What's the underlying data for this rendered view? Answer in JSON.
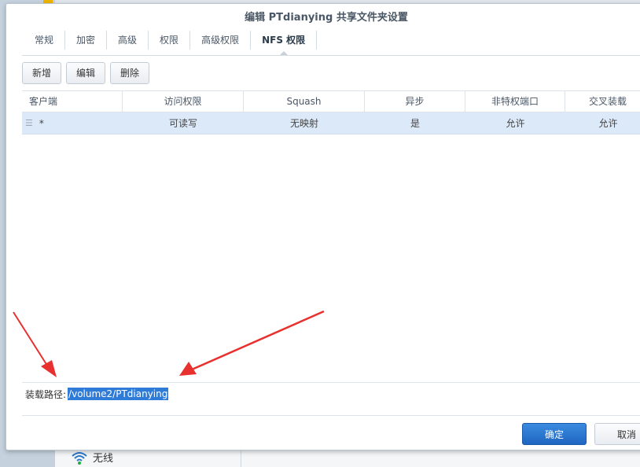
{
  "dialog": {
    "title": "编辑 PTdianying 共享文件夹设置"
  },
  "tabs": [
    {
      "label": "常规"
    },
    {
      "label": "加密"
    },
    {
      "label": "高级"
    },
    {
      "label": "权限"
    },
    {
      "label": "高级权限"
    },
    {
      "label": "NFS 权限",
      "active": true
    }
  ],
  "toolbar": {
    "add_label": "新增",
    "edit_label": "编辑",
    "delete_label": "删除"
  },
  "grid": {
    "headers": [
      "客户端",
      "访问权限",
      "Squash",
      "异步",
      "非特权端口",
      "交叉装载"
    ],
    "rows": [
      [
        "*",
        "可读写",
        "无映射",
        "是",
        "允许",
        "允许"
      ]
    ]
  },
  "mount_path": {
    "label": "装载路径:",
    "value": "/volume2/PTdianying"
  },
  "footer": {
    "ok_label": "确定",
    "cancel_label": "取消"
  },
  "background": {
    "network_label": "无线"
  },
  "colors": {
    "accent": "#2f7bd8",
    "row_selected": "#dce9f8",
    "annotation_arrow": "#e8312f"
  }
}
